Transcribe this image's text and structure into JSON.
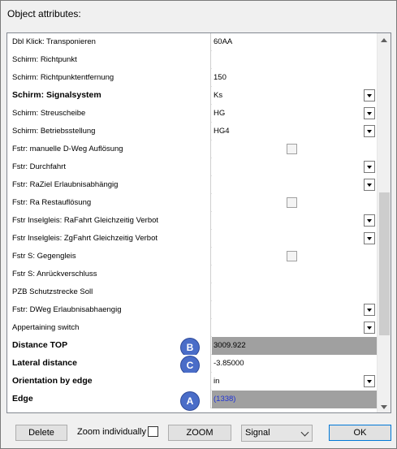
{
  "window": {
    "title": "Object attributes:"
  },
  "rows": [
    {
      "label": "Dbl Klick: Transponieren",
      "value": "60AA",
      "bold": false,
      "control": "text",
      "shaded": false,
      "badge": ""
    },
    {
      "label": "Schirm: Richtpunkt",
      "value": "",
      "bold": false,
      "control": "text",
      "shaded": false,
      "badge": ""
    },
    {
      "label": "Schirm: Richtpunktentfernung",
      "value": "150",
      "bold": false,
      "control": "text",
      "shaded": false,
      "badge": ""
    },
    {
      "label": "Schirm: Signalsystem",
      "value": "Ks",
      "bold": true,
      "control": "dropdown",
      "shaded": false,
      "badge": ""
    },
    {
      "label": "Schirm: Streuscheibe",
      "value": "HG",
      "bold": false,
      "control": "dropdown",
      "shaded": false,
      "badge": ""
    },
    {
      "label": "Schirm: Betriebsstellung",
      "value": "HG4",
      "bold": false,
      "control": "dropdown",
      "shaded": false,
      "badge": ""
    },
    {
      "label": "Fstr: manuelle D-Weg Auflösung",
      "value": "",
      "bold": false,
      "control": "checkbox",
      "shaded": false,
      "badge": ""
    },
    {
      "label": "Fstr: Durchfahrt",
      "value": "",
      "bold": false,
      "control": "dropdown",
      "shaded": false,
      "badge": ""
    },
    {
      "label": "Fstr: RaZiel Erlaubnisabhängig",
      "value": "",
      "bold": false,
      "control": "dropdown",
      "shaded": false,
      "badge": ""
    },
    {
      "label": "Fstr: Ra Restauflösung",
      "value": "",
      "bold": false,
      "control": "checkbox",
      "shaded": false,
      "badge": ""
    },
    {
      "label": "Fstr Inselgleis: RaFahrt Gleichzeitig Verbot",
      "value": "",
      "bold": false,
      "control": "dropdown",
      "shaded": false,
      "badge": ""
    },
    {
      "label": "Fstr Inselgleis: ZgFahrt Gleichzeitig Verbot",
      "value": "",
      "bold": false,
      "control": "dropdown",
      "shaded": false,
      "badge": ""
    },
    {
      "label": "Fstr S: Gegengleis",
      "value": "",
      "bold": false,
      "control": "checkbox",
      "shaded": false,
      "badge": ""
    },
    {
      "label": "Fstr S: Anrückverschluss",
      "value": "",
      "bold": false,
      "control": "text",
      "shaded": false,
      "badge": ""
    },
    {
      "label": "PZB Schutzstrecke Soll",
      "value": "",
      "bold": false,
      "control": "text",
      "shaded": false,
      "badge": ""
    },
    {
      "label": "Fstr: DWeg Erlaubnisabhaengig",
      "value": "",
      "bold": false,
      "control": "dropdown",
      "shaded": false,
      "badge": ""
    },
    {
      "label": "Appertaining switch",
      "value": "",
      "bold": false,
      "control": "dropdown",
      "shaded": false,
      "badge": ""
    },
    {
      "label": "Distance TOP",
      "value": "3009.922",
      "bold": true,
      "control": "text",
      "shaded": true,
      "badge": "B"
    },
    {
      "label": "Lateral distance",
      "value": "-3.85000",
      "bold": true,
      "control": "text",
      "shaded": false,
      "badge": "C"
    },
    {
      "label": "Orientation by edge",
      "value": "in",
      "bold": true,
      "control": "dropdown",
      "shaded": false,
      "badge": ""
    },
    {
      "label": "Edge",
      "value": "(1338)",
      "bold": true,
      "control": "link",
      "shaded": true,
      "badge": "A"
    }
  ],
  "footer": {
    "delete_label": "Delete",
    "zoom_individually_label": "Zoom individually",
    "zoom_label": "ZOOM",
    "type_select_value": "Signal",
    "ok_label": "OK"
  },
  "colors": {
    "badge": "#4a6dc8",
    "link": "#1f33d6",
    "shaded_cell": "#a0a0a0",
    "ok_border": "#0078d7"
  }
}
